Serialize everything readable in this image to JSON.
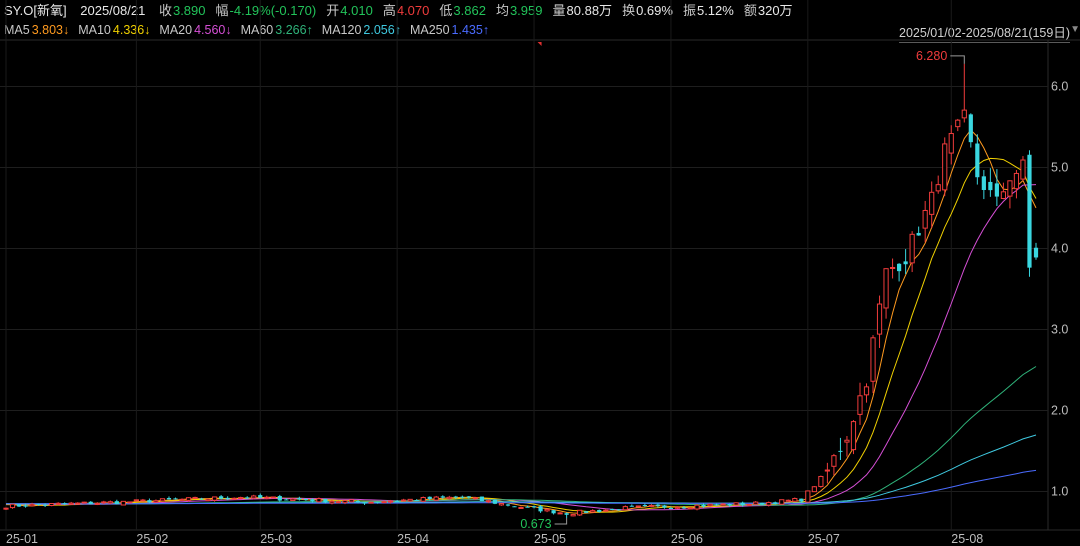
{
  "header": {
    "symbol": "SY.O[新氧]",
    "date": "2025/08/21",
    "fields": [
      {
        "label": "收",
        "value": "3.890",
        "tone": "down"
      },
      {
        "label": "幅",
        "value": "-4.19%(-0.170)",
        "tone": "down"
      },
      {
        "label": "开",
        "value": "4.010",
        "tone": "down"
      },
      {
        "label": "高",
        "value": "4.070",
        "tone": "up"
      },
      {
        "label": "低",
        "value": "3.862",
        "tone": "down"
      },
      {
        "label": "均",
        "value": "3.959",
        "tone": "down"
      },
      {
        "label": "量",
        "value": "80.88万",
        "tone": "neutral"
      },
      {
        "label": "换",
        "value": "0.69%",
        "tone": "neutral"
      },
      {
        "label": "振",
        "value": "5.12%",
        "tone": "neutral"
      },
      {
        "label": "额",
        "value": "320万",
        "tone": "neutral"
      }
    ],
    "range_label": "2025/01/02-2025/08/21(159日)",
    "range_arrow": "▼"
  },
  "moving_averages": [
    {
      "name": "MA5",
      "value": "3.803",
      "dir": "↓",
      "color": "#ff9a1f"
    },
    {
      "name": "MA10",
      "value": "4.336",
      "dir": "↓",
      "color": "#f0d000"
    },
    {
      "name": "MA20",
      "value": "4.560",
      "dir": "↓",
      "color": "#d64fd6"
    },
    {
      "name": "MA60",
      "value": "3.266",
      "dir": "↑",
      "color": "#2fb37a"
    },
    {
      "name": "MA120",
      "value": "2.056",
      "dir": "↑",
      "color": "#3fc9e0"
    },
    {
      "name": "MA250",
      "value": "1.435",
      "dir": "↑",
      "color": "#4a6bff"
    }
  ],
  "chart_data": {
    "type": "candlestick",
    "x_ticks": [
      "25-01",
      "25-02",
      "25-03",
      "25-04",
      "25-05",
      "25-06",
      "25-07",
      "25-08"
    ],
    "y_ticks": [
      "1.0",
      "2.0",
      "3.0",
      "4.0",
      "5.0",
      "6.0"
    ],
    "ylim": [
      0.55,
      6.55
    ],
    "max_label": "6.280",
    "min_label": "0.673",
    "max_value": 6.28,
    "min_value": 0.673,
    "up_color": "#f03c3c",
    "down_color": "#3ad7e0",
    "anchors": [
      {
        "day": 0,
        "close": 0.82
      },
      {
        "day": 18,
        "close": 0.87
      },
      {
        "day": 36,
        "close": 0.93
      },
      {
        "day": 55,
        "close": 0.87
      },
      {
        "day": 70,
        "close": 0.93
      },
      {
        "day": 78,
        "close": 0.82
      },
      {
        "day": 86,
        "close": 0.73
      },
      {
        "day": 96,
        "close": 0.8
      },
      {
        "day": 115,
        "close": 0.85
      },
      {
        "day": 122,
        "close": 0.9
      },
      {
        "day": 126,
        "close": 1.25
      },
      {
        "day": 129,
        "close": 1.7
      },
      {
        "day": 132,
        "close": 2.4
      },
      {
        "day": 135,
        "close": 3.7
      },
      {
        "day": 138,
        "close": 3.9
      },
      {
        "day": 142,
        "close": 4.6
      },
      {
        "day": 144,
        "close": 5.2
      },
      {
        "day": 147,
        "close": 5.6
      },
      {
        "day": 149,
        "close": 4.9
      },
      {
        "day": 152,
        "close": 4.55
      },
      {
        "day": 154,
        "close": 4.9
      },
      {
        "day": 156,
        "close": 5.0
      },
      {
        "day": 157,
        "close": 3.75
      },
      {
        "day": 158,
        "close": 3.89
      }
    ]
  }
}
